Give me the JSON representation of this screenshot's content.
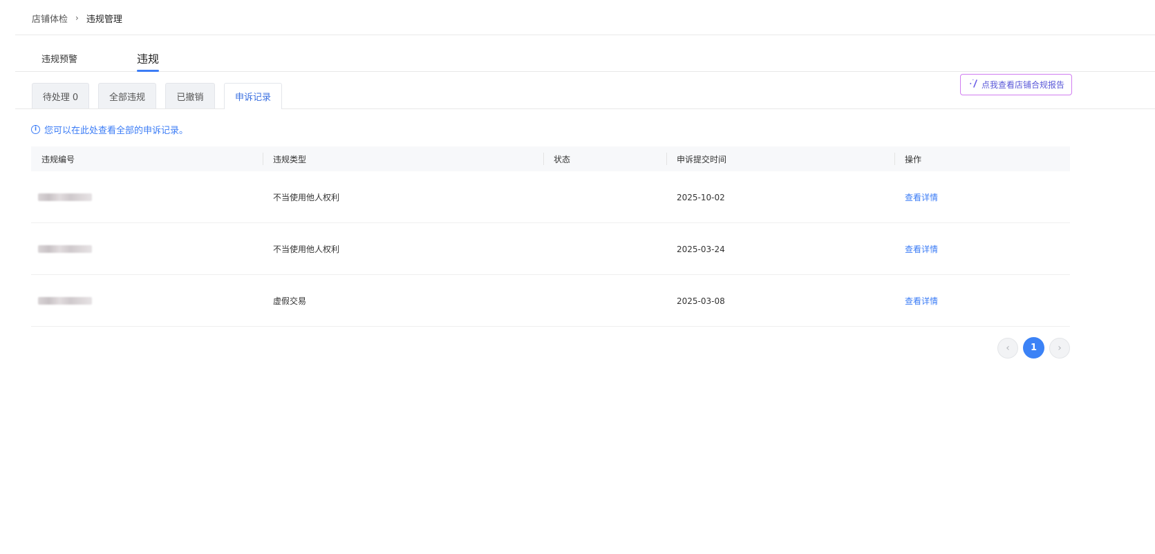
{
  "breadcrumb": {
    "parent": "店铺体检",
    "separator": "›",
    "current": "违规管理"
  },
  "main_tabs": [
    {
      "label": "违规预警"
    },
    {
      "label": "违规"
    }
  ],
  "compliance_button": {
    "icon": "sparkle-icon",
    "label": "点我查看店铺合规报告"
  },
  "sub_tabs": [
    {
      "label": "待处理 0"
    },
    {
      "label": "全部违规"
    },
    {
      "label": "已撤销"
    },
    {
      "label": "申诉记录"
    }
  ],
  "notice": {
    "icon": "info-icon",
    "text": "您可以在此处查看全部的申诉记录。"
  },
  "table": {
    "columns": [
      "违规编号",
      "违规类型",
      "状态",
      "申诉提交时间",
      "操作"
    ],
    "rows": [
      {
        "type": "不当使用他人权利",
        "status": "",
        "submit_time": "2025-10-02",
        "action": "查看详情"
      },
      {
        "type": "不当使用他人权利",
        "status": "",
        "submit_time": "2025-03-24",
        "action": "查看详情"
      },
      {
        "type": "虚假交易",
        "status": "",
        "submit_time": "2025-03-08",
        "action": "查看详情"
      }
    ]
  },
  "pagination": {
    "current_page": "1",
    "prev_icon": "chevron-left-icon",
    "next_icon": "chevron-right-icon"
  },
  "colors": {
    "accent": "#3b7cf6",
    "page_active": "#3b82f6",
    "report_border": "#d07cf0"
  }
}
